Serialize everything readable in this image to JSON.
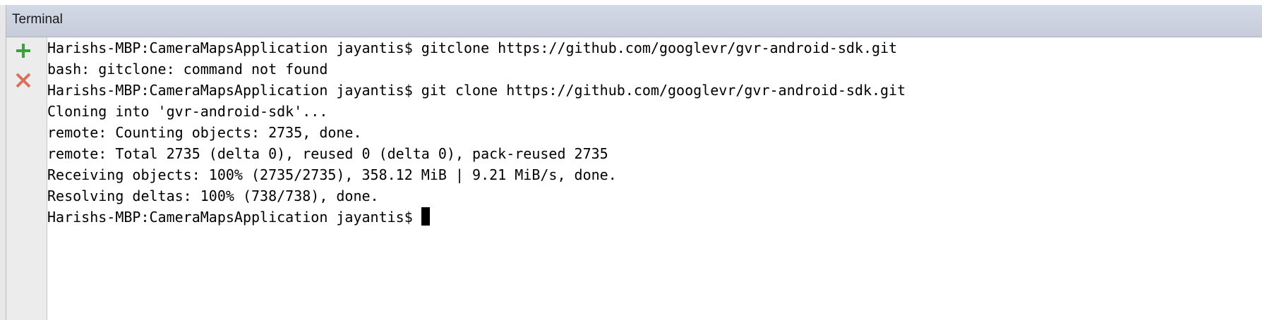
{
  "panel": {
    "title": "Terminal"
  },
  "gutter": {
    "buttons": [
      {
        "name": "new-session",
        "icon": "plus-icon",
        "color": "#3f9e3f"
      },
      {
        "name": "close-session",
        "icon": "close-icon",
        "color": "#d9705f"
      }
    ]
  },
  "terminal": {
    "lines": [
      "Harishs-MBP:CameraMapsApplication jayantis$ gitclone https://github.com/googlevr/gvr-android-sdk.git",
      "bash: gitclone: command not found",
      "Harishs-MBP:CameraMapsApplication jayantis$ git clone https://github.com/googlevr/gvr-android-sdk.git",
      "Cloning into 'gvr-android-sdk'...",
      "remote: Counting objects: 2735, done.",
      "remote: Total 2735 (delta 0), reused 0 (delta 0), pack-reused 2735",
      "Receiving objects: 100% (2735/2735), 358.12 MiB | 9.21 MiB/s, done.",
      "Resolving deltas: 100% (738/738), done."
    ],
    "prompt": "Harishs-MBP:CameraMapsApplication jayantis$ "
  }
}
